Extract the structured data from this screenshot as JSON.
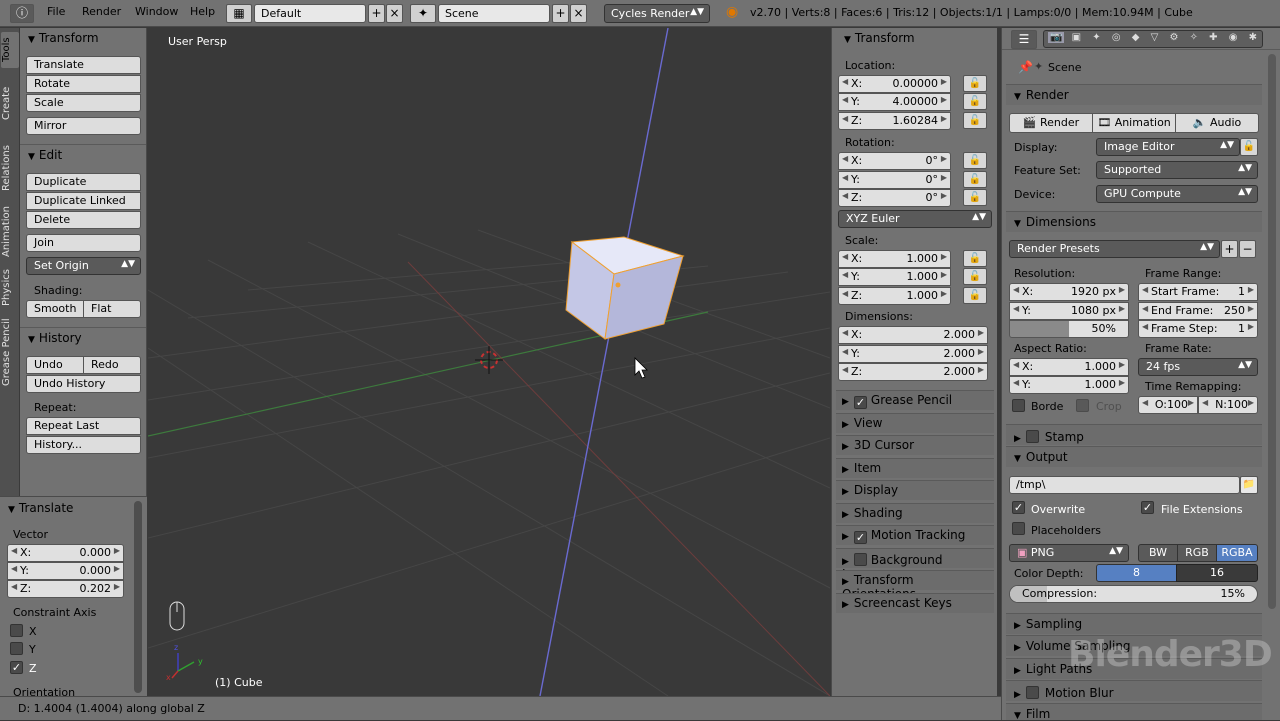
{
  "menu": {
    "file": "File",
    "render": "Render",
    "window": "Window",
    "help": "Help"
  },
  "layout_name": "Default",
  "scene_name": "Scene",
  "engine": "Cycles Render",
  "stats": "v2.70 | Verts:8 | Faces:6 | Tris:12 | Objects:1/1 | Lamps:0/0 | Mem:10.94M | Cube",
  "tabs": [
    "Tools",
    "Create",
    "Relations",
    "Animation",
    "Physics",
    "Grease Pencil"
  ],
  "tools": {
    "transform_head": "Transform",
    "translate": "Translate",
    "rotate": "Rotate",
    "scale": "Scale",
    "mirror": "Mirror",
    "edit_head": "Edit",
    "duplicate": "Duplicate",
    "duplicate_linked": "Duplicate Linked",
    "delete": "Delete",
    "join": "Join",
    "set_origin": "Set Origin",
    "shading_lbl": "Shading:",
    "smooth": "Smooth",
    "flat": "Flat",
    "history_head": "History",
    "undo": "Undo",
    "redo": "Redo",
    "undo_history": "Undo History",
    "repeat_lbl": "Repeat:",
    "repeat_last": "Repeat Last",
    "history_dots": "History..."
  },
  "redo_panel": {
    "head": "Translate",
    "vector": "Vector",
    "x_l": "X:",
    "x_v": "0.000",
    "y_l": "Y:",
    "y_v": "0.000",
    "z_l": "Z:",
    "z_v": "0.202",
    "constraint": "Constraint Axis",
    "cx": "X",
    "cy": "Y",
    "cz": "Z",
    "orientation": "Orientation"
  },
  "viewport": {
    "persp": "User Persp",
    "obj": "(1) Cube"
  },
  "npanel": {
    "head": "Transform",
    "location": "Location:",
    "lx": "X:",
    "lxv": "0.00000",
    "ly": "Y:",
    "lyv": "4.00000",
    "lz": "Z:",
    "lzv": "1.60284",
    "rotation": "Rotation:",
    "rx": "X:",
    "rxv": "0°",
    "ry": "Y:",
    "ryv": "0°",
    "rz": "Z:",
    "rzv": "0°",
    "euler": "XYZ Euler",
    "scale": "Scale:",
    "sx": "X:",
    "sxv": "1.000",
    "sy": "Y:",
    "syv": "1.000",
    "sz": "Z:",
    "szv": "1.000",
    "dims": "Dimensions:",
    "dx": "X:",
    "dxv": "2.000",
    "dy": "Y:",
    "dyv": "2.000",
    "dz": "Z:",
    "dzv": "2.000",
    "sections": [
      "Grease Pencil",
      "View",
      "3D Cursor",
      "Item",
      "Display",
      "Shading",
      "Motion Tracking",
      "Background Images",
      "Transform Orientations",
      "Screencast Keys"
    ]
  },
  "props": {
    "scene": "Scene",
    "render_head": "Render",
    "render_btn": "Render",
    "animation_btn": "Animation",
    "audio_btn": "Audio",
    "display_lbl": "Display:",
    "display_val": "Image Editor",
    "feature_lbl": "Feature Set:",
    "feature_val": "Supported",
    "device_lbl": "Device:",
    "device_val": "GPU Compute",
    "dims_head": "Dimensions",
    "presets": "Render Presets",
    "res_lbl": "Resolution:",
    "res_x_l": "X:",
    "res_x": "1920 px",
    "res_y_l": "Y:",
    "res_y": "1080 px",
    "res_pct": "50%",
    "fr_lbl": "Frame Range:",
    "start_l": "Start Frame:",
    "start": "1",
    "end_l": "End Frame:",
    "end": "250",
    "step_l": "Frame Step:",
    "step": "1",
    "aspect_lbl": "Aspect Ratio:",
    "ax_l": "X:",
    "ax": "1.000",
    "ay_l": "Y:",
    "ay": "1.000",
    "rate_lbl": "Frame Rate:",
    "rate": "24 fps",
    "remap_lbl": "Time Remapping:",
    "old": "O:100",
    "new": "N:100",
    "border": "Borde",
    "crop": "Crop",
    "stamp": "Stamp",
    "output_head": "Output",
    "path": "/tmp\\",
    "overwrite": "Overwrite",
    "file_ext": "File Extensions",
    "placeholders": "Placeholders",
    "format": "PNG",
    "bw": "BW",
    "rgb": "RGB",
    "rgba": "RGBA",
    "depth_lbl": "Color Depth:",
    "d8": "8",
    "d16": "16",
    "compression": "Compression:",
    "comp_val": "15%",
    "comp_fraction": 0.15,
    "sampling": "Sampling",
    "volume": "Volume Sampling",
    "light": "Light Paths",
    "motion": "Motion Blur",
    "film": "Film"
  },
  "status": "D: 1.4004 (1.4004) along global Z",
  "watermark": "Blender3D",
  "colors": {
    "accent": "#5680c2",
    "header": "#727272",
    "viewport": "#393939",
    "cube": "#c8cae8",
    "x_axis": "#8a3a3a",
    "y_axis": "#3a8a3a",
    "z_axis": "#5a5ab8"
  }
}
